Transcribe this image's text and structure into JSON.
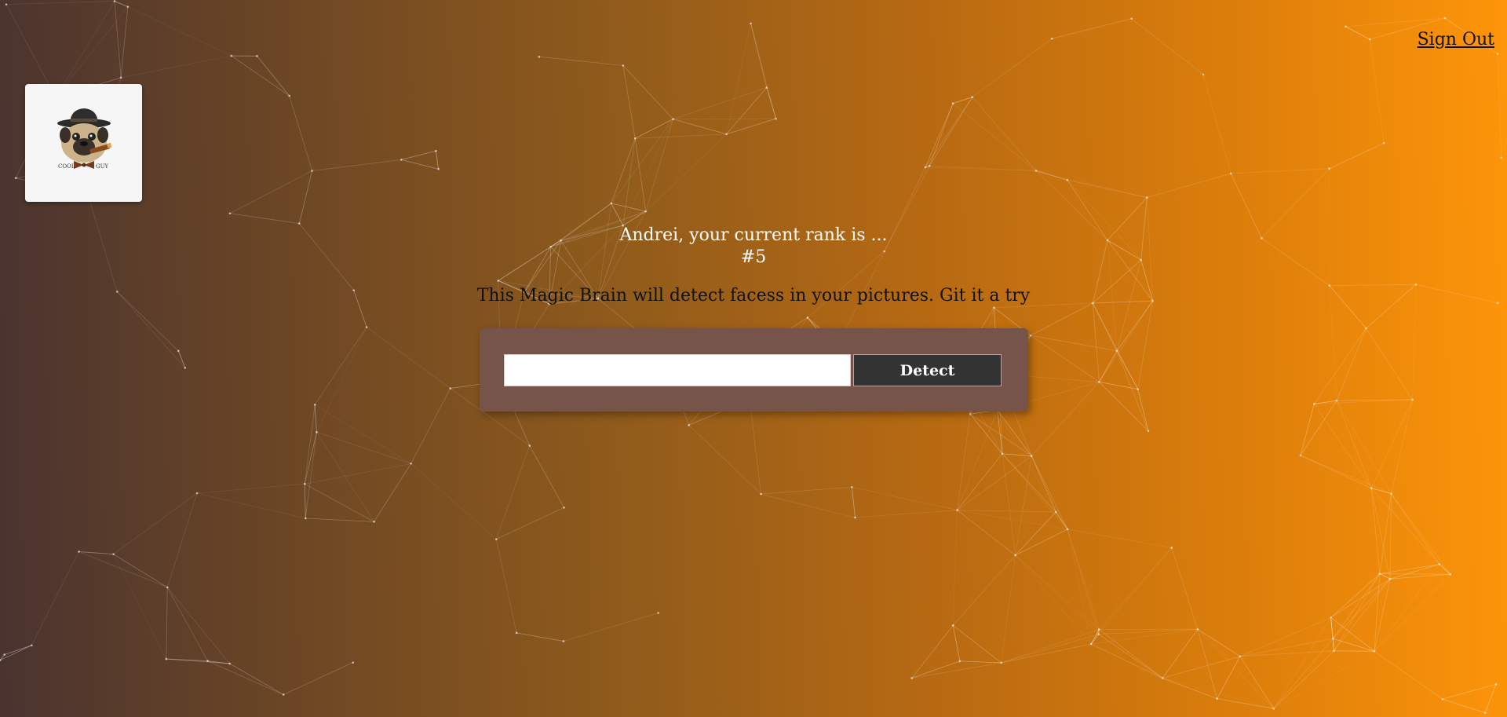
{
  "nav": {
    "signout_label": "Sign Out"
  },
  "logo": {
    "text_left": "COOL",
    "text_right": "GUY"
  },
  "rank": {
    "message": "Andrei, your current rank is ...",
    "value": "#5"
  },
  "intro": {
    "text": "This Magic Brain will detect facess in your pictures. Git it a try"
  },
  "form": {
    "input_value": "",
    "input_placeholder": "",
    "button_label": "Detect"
  },
  "colors": {
    "gradient_start": "#4a3430",
    "gradient_end": "#fe950a",
    "form_panel": "#77544a",
    "button_bg": "#333333",
    "particle_line": "#ffffff"
  }
}
